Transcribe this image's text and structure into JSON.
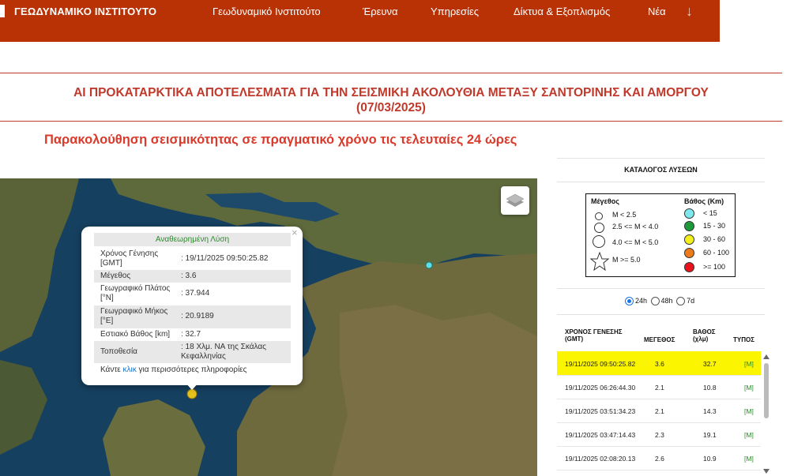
{
  "header": {
    "brand": "ΓΕΩΔΥΝΑΜΙΚΟ ΙΝΣΤΙΤΟΥΤΟ",
    "nav": [
      "Γεωδυναμικό Ινστιτούτο",
      "Έρευνα",
      "Υπηρεσίες",
      "Δίκτυα & Εξοπλισμός",
      "Νέα"
    ],
    "nav_more_icon": "arrow-down-icon",
    "bg_color": "#b83206"
  },
  "headline": {
    "line1": "ΑΙ ΠΡΟΚΑΤΑΡΚΤΙΚΑ ΑΠΟΤΕΛΕΣΜΑΤΑ ΓΙΑ ΤΗΝ ΣΕΙΣΜΙΚΗ ΑΚΟΛΟΥΘΙΑ ΜΕΤΑΞΥ ΣΑΝΤΟΡΙΝΗΣ ΚΑΙ ΑΜΟΡΓΟΥ",
    "line2": "(07/03/2025)",
    "color": "#c0392b"
  },
  "subheading": "Παρακολούθηση σεισμικότητας σε πραγματικό χρόνο τις τελευταίες 24 ώρες",
  "map": {
    "layers_icon": "layers-icon",
    "popup": {
      "title": "Αναθεωρημένη Λύση",
      "rows": [
        {
          "label": "Χρόνος Γένησης [GMT]",
          "value": ": 19/11/2025 09:50:25.82"
        },
        {
          "label": "Μέγεθος",
          "value": ": 3.6"
        },
        {
          "label": "Γεωγραφικό Πλάτος [°N]",
          "value": ": 37.944"
        },
        {
          "label": "Γεωγραφικό Μήκος [°E]",
          "value": ": 20.9189"
        },
        {
          "label": "Εστιακό Βάθος [km]",
          "value": ": 32.7"
        },
        {
          "label": "Τοποθεσία",
          "value": ": 18 Χλμ. ΝΑ της Σκάλας Κεφαλληνίας"
        }
      ],
      "more_prefix": "Κάντε ",
      "more_link": "κλικ",
      "more_suffix": " για περισσότερες πληροφορίες",
      "close": "×"
    }
  },
  "sidebar": {
    "title": "ΚΑΤΑΛΟΓΟΣ ΛΥΣΕΩΝ",
    "legend": {
      "magnitude_title": "Μέγεθος",
      "magnitudes": [
        "M < 2.5",
        "2.5 <= M < 4.0",
        "4.0 <= M < 5.0",
        "M >= 5.0"
      ],
      "depth_title": "Βάθος (Km)",
      "depths": [
        {
          "label": "< 15",
          "color": "#7fe8ee"
        },
        {
          "label": "15 - 30",
          "color": "#1f9a3a"
        },
        {
          "label": "30 - 60",
          "color": "#f2ef1a"
        },
        {
          "label": "60 - 100",
          "color": "#ef7a1a"
        },
        {
          "label": ">= 100",
          "color": "#e8131c"
        }
      ]
    },
    "ranges": [
      {
        "label": "24h",
        "selected": true
      },
      {
        "label": "48h",
        "selected": false
      },
      {
        "label": "7d",
        "selected": false
      }
    ],
    "table": {
      "headers": {
        "time_1": "ΧΡΟΝΟΣ ΓΕΝΕΣΗΣ",
        "time_2": "(GMT)",
        "mag": "ΜΕΓΕΘΟΣ",
        "depth_1": "ΒΑΘΟΣ",
        "depth_2": "(χλμ)",
        "type": "ΤΥΠΟΣ"
      },
      "rows": [
        {
          "time": "19/11/2025 09:50:25.82",
          "mag": "3.6",
          "depth": "32.7",
          "type": "[M]"
        },
        {
          "time": "19/11/2025 06:26:44.30",
          "mag": "2.1",
          "depth": "10.8",
          "type": "[M]"
        },
        {
          "time": "19/11/2025 03:51:34.23",
          "mag": "2.1",
          "depth": "14.3",
          "type": "[M]"
        },
        {
          "time": "19/11/2025 03:47:14.43",
          "mag": "2.3",
          "depth": "19.1",
          "type": "[M]"
        },
        {
          "time": "19/11/2025 02:08:20.13",
          "mag": "2.6",
          "depth": "10.9",
          "type": "[M]"
        }
      ]
    }
  }
}
